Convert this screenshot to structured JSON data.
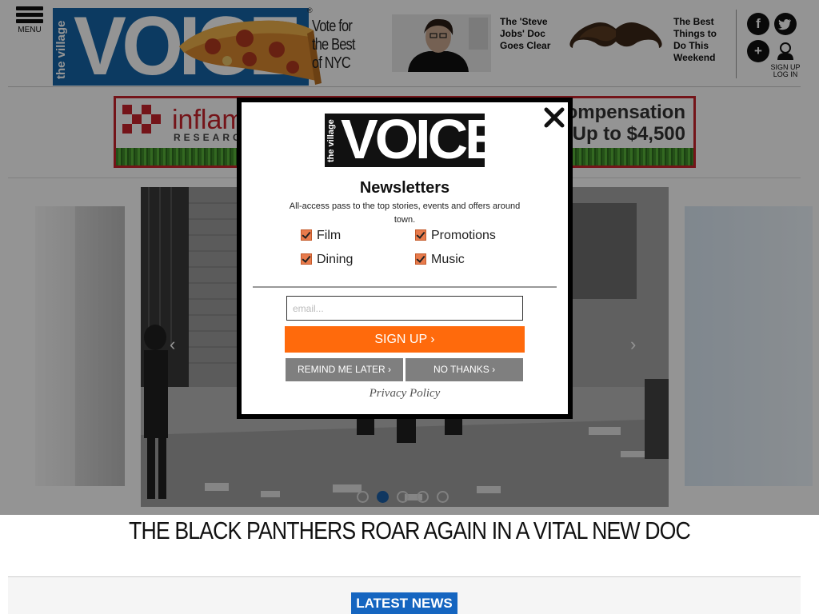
{
  "header": {
    "menu_label": "MENU",
    "logo_small": "the village",
    "logo_word": "VOICE",
    "registered": "®",
    "tagline": [
      "Vote for",
      "the Best",
      "of NYC"
    ],
    "promo1": "The 'Steve Jobs' Doc Goes Clear",
    "promo2": "The Best Things to Do This Weekend",
    "facebook_glyph": "f",
    "plus_glyph": "+",
    "signup_label": "SIGN UP",
    "login_label": "LOG IN"
  },
  "ad": {
    "brand": "inflam",
    "brand_sub": "RESEARCH",
    "offer_line1": "Compensation",
    "offer_line2": "Up to $4,500"
  },
  "carousel": {
    "prev_arrow": "‹",
    "next_arrow": "›",
    "slide_count": 5,
    "active_slide": 2,
    "headline": "THE BLACK PANTHERS ROAR AGAIN IN A VITAL NEW DOC"
  },
  "latest_news": "LATEST NEWS",
  "modal": {
    "close_glyph": "✕",
    "logo_small": "the village",
    "logo_word": "VOICE",
    "title": "Newsletters",
    "subtitle": "All-access pass to the top stories, events and offers around town.",
    "options": [
      {
        "label": "Film",
        "checked": true
      },
      {
        "label": "Promotions",
        "checked": true
      },
      {
        "label": "Dining",
        "checked": true
      },
      {
        "label": "Music",
        "checked": true
      }
    ],
    "email_placeholder": "email...",
    "signup_button": "SIGN UP ›",
    "remind_button": "REMIND ME LATER ›",
    "nothanks_button": "NO THANKS ›",
    "privacy_link": "Privacy Policy"
  },
  "colors": {
    "brand_blue": "#1565a8",
    "signup_orange": "#ff6a0c",
    "grey_button": "#7f7f7f",
    "latest_blue": "#1565c0",
    "ad_red": "#c8232c"
  }
}
